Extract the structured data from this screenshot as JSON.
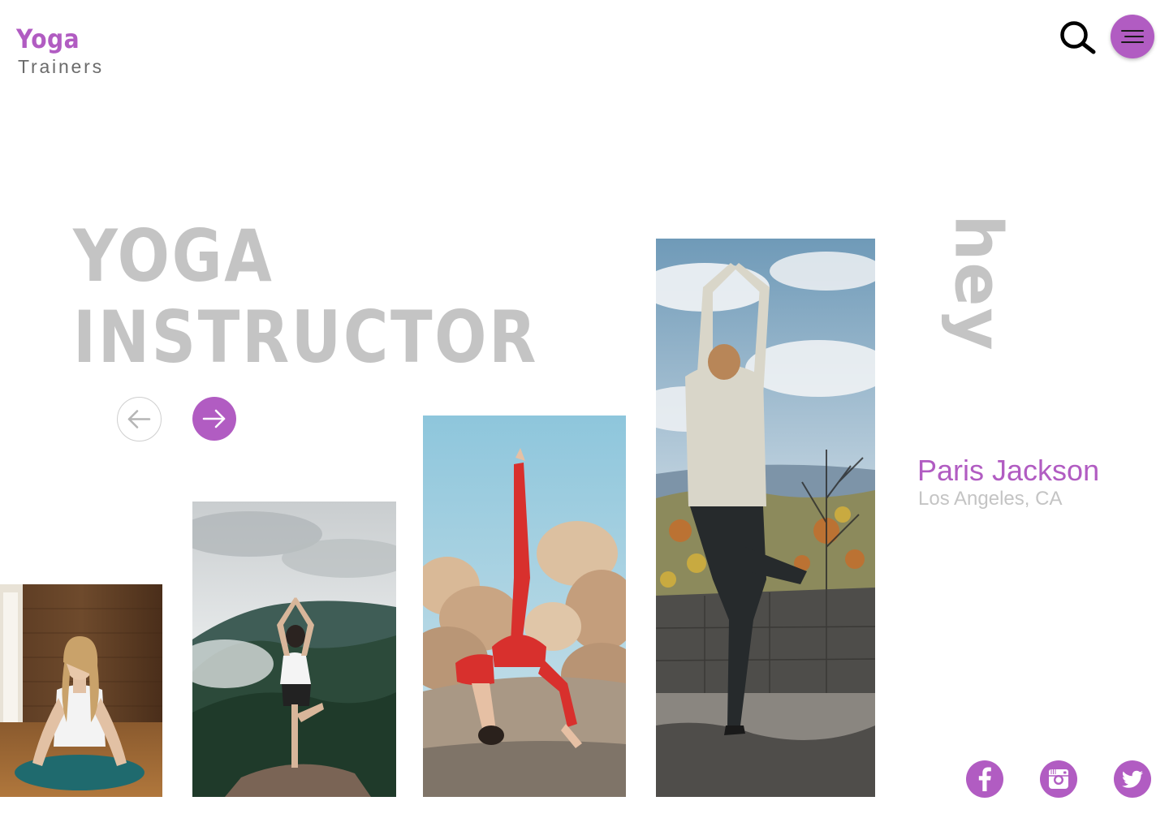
{
  "brand": {
    "name": "Yoga",
    "subtitle": "Trainers"
  },
  "header": {
    "search_icon": "search-icon",
    "menu_icon": "hamburger-menu-icon"
  },
  "hero": {
    "line1": "YOGA",
    "line2": "INSTRUCTOR"
  },
  "carousel": {
    "prev_icon": "arrow-left-icon",
    "next_icon": "arrow-right-icon"
  },
  "vertical_word": "hey",
  "trainer": {
    "name": "Paris Jackson",
    "location": "Los Angeles, CA"
  },
  "social": [
    {
      "icon": "facebook-icon"
    },
    {
      "icon": "instagram-icon"
    },
    {
      "icon": "twitter-icon"
    }
  ],
  "colors": {
    "accent": "#b15cc2",
    "muted_text": "#c4c4c4",
    "subtitle_text": "#6b6b6b"
  }
}
